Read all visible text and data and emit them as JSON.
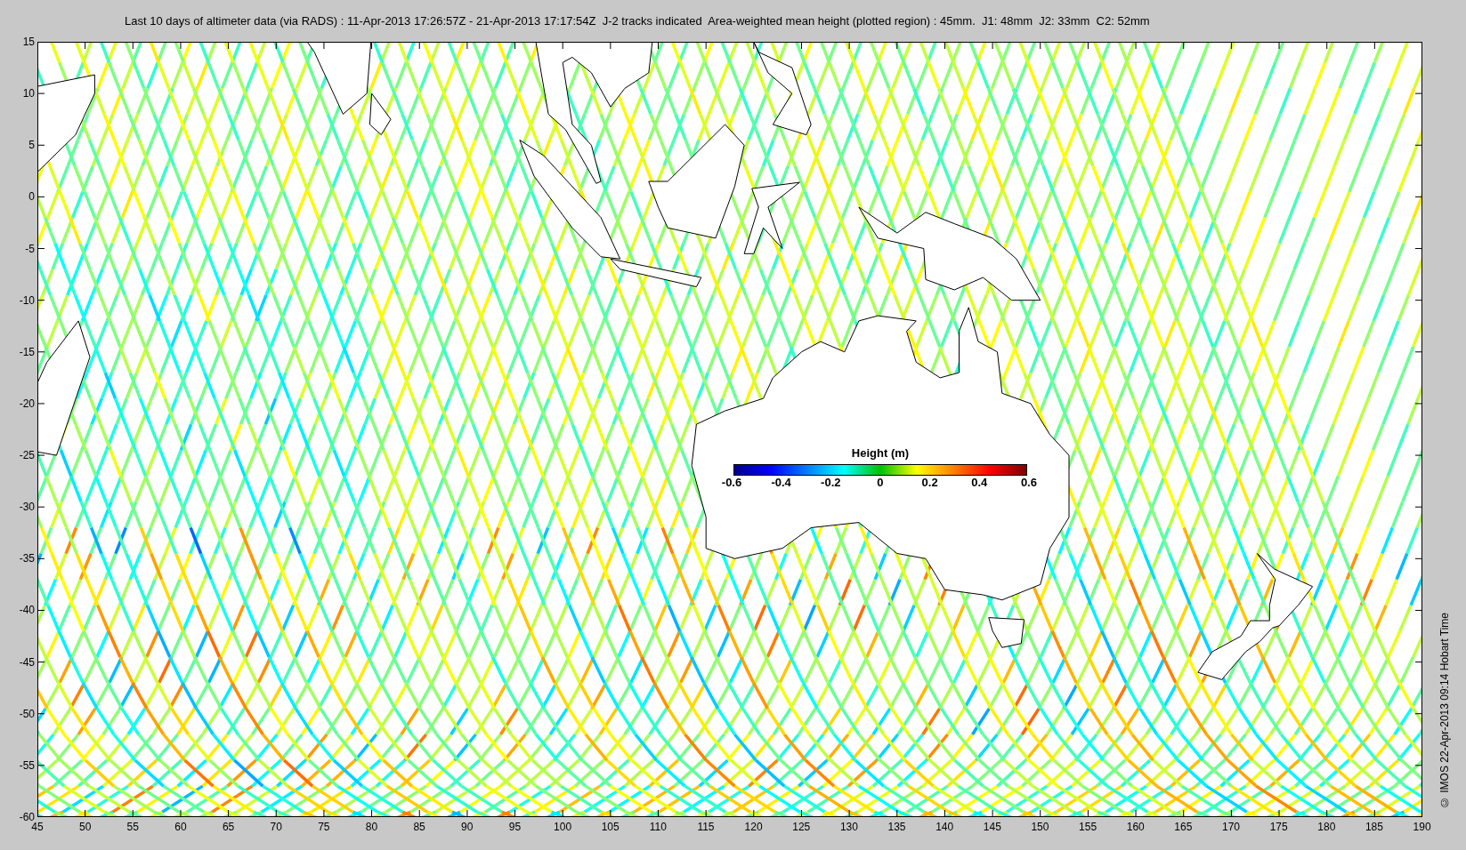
{
  "title": "Last 10 days of altimeter data (via RADS) : 11-Apr-2013 17:26:57Z - 21-Apr-2013 17:17:54Z  J-2 tracks indicated  Area-weighted mean height (plotted region) : 45mm.  J1: 48mm  J2: 33mm  C2: 52mm",
  "map": {
    "y_axis_labels": [
      "15",
      "10",
      "5",
      "0",
      "-5",
      "-10",
      "-15",
      "-20",
      "-25",
      "-30",
      "-35",
      "-40",
      "-45",
      "-50",
      "-55",
      "-60"
    ],
    "x_axis_labels": [
      "45",
      "50",
      "55",
      "60",
      "65",
      "70",
      "75",
      "80",
      "85",
      "90",
      "95",
      "100",
      "105",
      "110",
      "115",
      "120",
      "125",
      "130",
      "135",
      "140",
      "145",
      "150",
      "155",
      "160",
      "165",
      "170",
      "175",
      "180",
      "185",
      "190"
    ],
    "colorbar": {
      "title": "Height (m)",
      "tick_labels": [
        "-0.6",
        "-0.4",
        "-0.2",
        "0",
        "0.2",
        "0.4",
        "0.6"
      ]
    }
  },
  "credit": "© IMOS 22-Apr-2013 09:14 Hobart Time"
}
